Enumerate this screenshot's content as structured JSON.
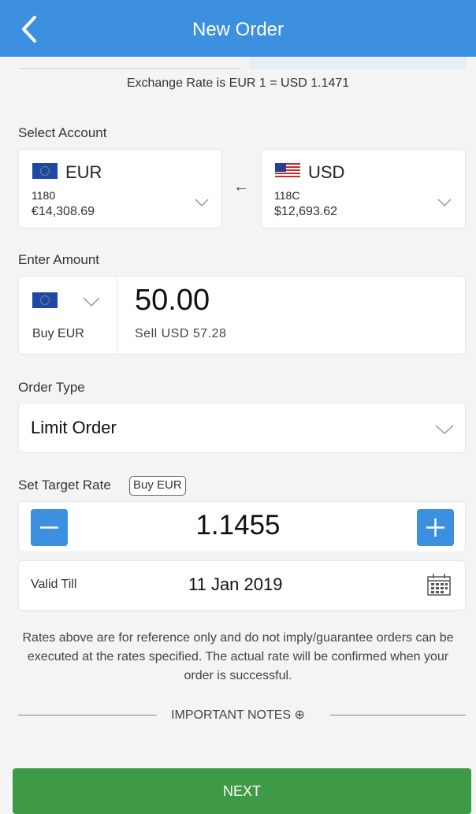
{
  "header": {
    "title": "New Order"
  },
  "exchange_rate_text": "Exchange Rate is EUR 1 = USD 1.1471",
  "select_account": {
    "label": "Select Account",
    "from": {
      "currency": "EUR",
      "account": "1180",
      "balance": "€14,308.69"
    },
    "to": {
      "currency": "USD",
      "account": "118C",
      "balance": "$12,693.62"
    },
    "arrow": "←"
  },
  "enter_amount": {
    "label": "Enter Amount",
    "buy_label": "Buy EUR",
    "amount": "50.00",
    "sell_text": "Sell USD 57.28"
  },
  "order_type": {
    "label": "Order Type",
    "value": "Limit Order"
  },
  "target_rate": {
    "label": "Set Target Rate",
    "badge": "Buy EUR",
    "value": "1.1455",
    "minus": "−",
    "plus": "+"
  },
  "valid_till": {
    "label": "Valid Till",
    "date": "11 Jan 2019"
  },
  "disclaimer": "Rates above are for reference only and do not imply/guarantee orders can be executed at the rates specified. The actual rate will be confirmed when your order is successful.",
  "important_notes": {
    "label": "IMPORTANT NOTES",
    "icon": "⊕"
  },
  "next_button": {
    "label": "NEXT"
  },
  "colors": {
    "header": "#3d8fe0",
    "next": "#3f9a47",
    "stepper": "#3d8fe0"
  }
}
